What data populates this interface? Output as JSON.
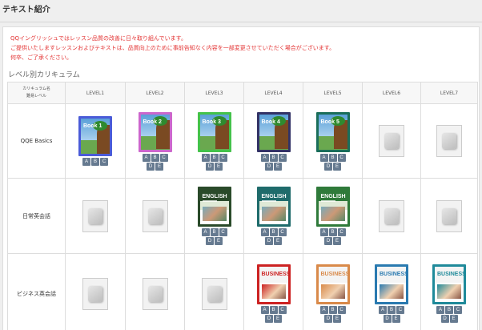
{
  "page": {
    "title": "テキスト紹介"
  },
  "notice": {
    "lines": [
      "QQイングリッシュではレッスン品質の改善に日々取り組んでいます。",
      "ご提供いたしますレッスンおよびテキストは、品質向上のために事前告知なく内容を一部変更させていただく場合がございます。",
      "何卒、ご了承ください。"
    ],
    "color": "#e33333"
  },
  "curriculum": {
    "section_title": "レベル別カリキュラム",
    "header_label_1": "カリキュラム名",
    "header_label_2": "難易レベル",
    "levels": [
      "LEVEL1",
      "LEVEL2",
      "LEVEL3",
      "LEVEL4",
      "LEVEL5",
      "LEVEL6",
      "LEVEL7"
    ],
    "rows": [
      {
        "name": "QQE Basics",
        "cells": [
          {
            "type": "book",
            "style": "basics",
            "border": "#4a5bd8",
            "title": "Book 1",
            "chips": [
              "A",
              "B",
              "C"
            ]
          },
          {
            "type": "book",
            "style": "basics",
            "border": "#cc66cc",
            "title": "Book 2",
            "chips": [
              "A",
              "B",
              "C",
              "D",
              "E"
            ]
          },
          {
            "type": "book",
            "style": "basics",
            "border": "#44c24a",
            "title": "Book 3",
            "chips": [
              "A",
              "B",
              "C",
              "D",
              "E"
            ]
          },
          {
            "type": "book",
            "style": "basics",
            "border": "#333366",
            "title": "Book 4",
            "chips": [
              "A",
              "B",
              "C",
              "D",
              "E"
            ]
          },
          {
            "type": "book",
            "style": "basics",
            "border": "#1a6e5a",
            "title": "Book 5",
            "chips": [
              "A",
              "B",
              "C",
              "D",
              "E"
            ]
          },
          {
            "type": "placeholder"
          },
          {
            "type": "placeholder"
          }
        ]
      },
      {
        "name": "日常英会話",
        "cells": [
          {
            "type": "placeholder"
          },
          {
            "type": "placeholder"
          },
          {
            "type": "book",
            "style": "daily",
            "border": "#2a4a2a",
            "title": "ENGLISH",
            "num": "3",
            "chips": [
              "A",
              "B",
              "C",
              "D",
              "E"
            ]
          },
          {
            "type": "book",
            "style": "daily",
            "border": "#1f6b6b",
            "title": "ENGLISH",
            "num": "4",
            "chips": [
              "A",
              "B",
              "C",
              "D",
              "E"
            ]
          },
          {
            "type": "book",
            "style": "daily",
            "border": "#2f7a3a",
            "title": "ENGLISH",
            "num": "5",
            "chips": [
              "A",
              "B",
              "C",
              "D",
              "E"
            ]
          },
          {
            "type": "placeholder"
          },
          {
            "type": "placeholder"
          }
        ]
      },
      {
        "name": "ビジネス英会話",
        "cells": [
          {
            "type": "placeholder"
          },
          {
            "type": "placeholder"
          },
          {
            "type": "placeholder"
          },
          {
            "type": "book",
            "style": "business",
            "border": "#cc2222",
            "title": "BUSINESS",
            "num": "4",
            "chips": [
              "A",
              "B",
              "C",
              "D",
              "E"
            ]
          },
          {
            "type": "book",
            "style": "business",
            "border": "#d98a4a",
            "title": "BUSINESS",
            "num": "5",
            "chips": [
              "A",
              "B",
              "C",
              "D",
              "E"
            ]
          },
          {
            "type": "book",
            "style": "business",
            "border": "#2a7ab0",
            "title": "BUSINESS",
            "num": "6",
            "chips": [
              "A",
              "B",
              "C",
              "D",
              "E"
            ]
          },
          {
            "type": "book",
            "style": "business",
            "border": "#1f8a9a",
            "title": "BUSINESS",
            "num": "7",
            "chips": [
              "A",
              "B",
              "C",
              "D",
              "E"
            ]
          }
        ]
      }
    ]
  }
}
